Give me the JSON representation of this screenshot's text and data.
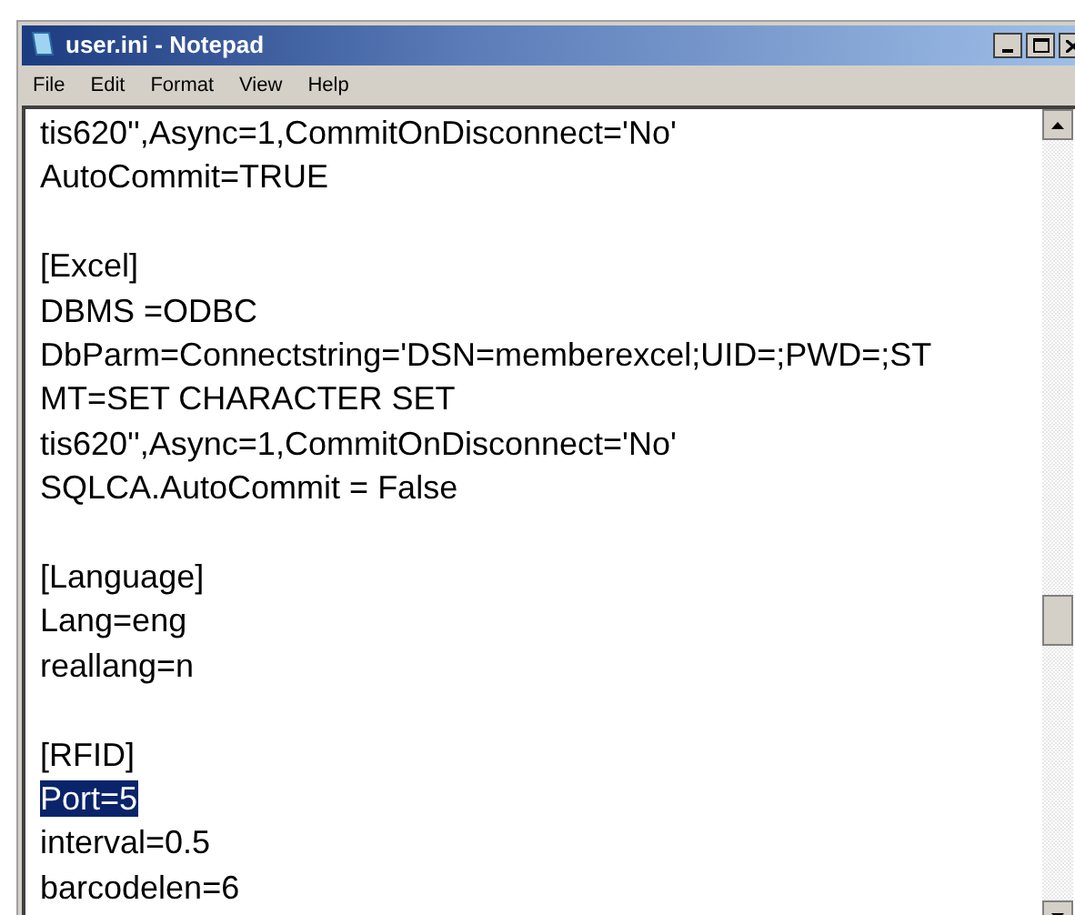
{
  "window": {
    "title": "user.ini - Notepad"
  },
  "menu": [
    {
      "label": "File",
      "selected": false
    },
    {
      "label": "Edit",
      "selected": false
    },
    {
      "label": "Format",
      "selected": false
    },
    {
      "label": "View",
      "selected": false
    },
    {
      "label": "Help",
      "selected": false
    }
  ],
  "lines": [
    {
      "kind": "text",
      "text": "tis620'',Async=1,CommitOnDisconnect='No'",
      "selected": false
    },
    {
      "kind": "text",
      "text": "AutoCommit=TRUE",
      "selected": false
    },
    {
      "kind": "blank"
    },
    {
      "kind": "text",
      "text": "[Excel]",
      "selected": false
    },
    {
      "kind": "text",
      "text": "DBMS =ODBC",
      "selected": false
    },
    {
      "kind": "text",
      "text": "DbParm=Connectstring='DSN=memberexcel;UID=;PWD=;ST",
      "selected": false
    },
    {
      "kind": "text",
      "text": "MT=SET CHARACTER SET",
      "selected": false
    },
    {
      "kind": "text",
      "text": "tis620'',Async=1,CommitOnDisconnect='No'",
      "selected": false
    },
    {
      "kind": "text",
      "text": "SQLCA.AutoCommit = False",
      "selected": false
    },
    {
      "kind": "blank"
    },
    {
      "kind": "text",
      "text": "[Language]",
      "selected": false
    },
    {
      "kind": "text",
      "text": "Lang=eng",
      "selected": false
    },
    {
      "kind": "text",
      "text": "reallang=n",
      "selected": false
    },
    {
      "kind": "blank"
    },
    {
      "kind": "text",
      "text": "[RFID]",
      "selected": false
    },
    {
      "kind": "text",
      "text": "Port=5",
      "selected": true
    },
    {
      "kind": "text",
      "text": "interval=0.5",
      "selected": false
    },
    {
      "kind": "text",
      "text": "barcodelen=6",
      "selected": false
    }
  ]
}
